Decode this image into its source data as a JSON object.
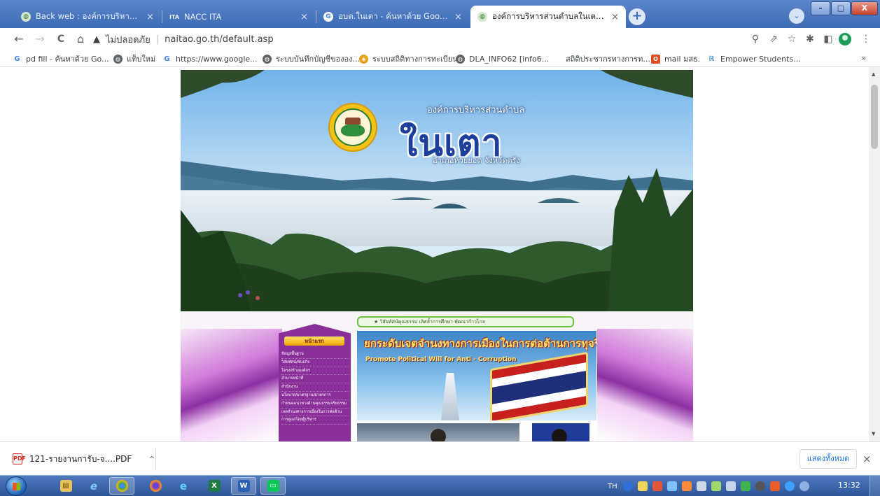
{
  "browser": {
    "tabs": [
      {
        "title": "Back web : องค์การบริหารส่วนตำบลใ",
        "close": "×",
        "favicon": "globe-icon",
        "active": false
      },
      {
        "title": "NACC ITA",
        "close": "×",
        "favicon": "ita-icon",
        "active": false
      },
      {
        "title": "อบต.ในเตา - ค้นหาด้วย Google",
        "close": "×",
        "favicon": "google-icon",
        "active": false
      },
      {
        "title": "องค์การบริหารส่วนตำบลในเตา เลขที่ 1",
        "close": "×",
        "favicon": "globe-icon",
        "active": true
      }
    ],
    "new_tab": "+",
    "tab_search": "⌄",
    "window_controls": {
      "minimize": "–",
      "maximize": "□",
      "close": "X"
    },
    "toolbar": {
      "back": "←",
      "forward": "→",
      "reload": "C",
      "home": "⌂",
      "security_warning": "▲",
      "security_text": "ไม่ปลอดภัย",
      "separator": "|",
      "url": "naitao.go.th/default.asp",
      "zoom": "⚲",
      "share": "⇗",
      "star": "☆",
      "extensions": "✱",
      "sidepanel": "◧",
      "menu": "⋮"
    },
    "bookmarks": [
      {
        "label": "pd fill - ค้นหาด้วย Go...",
        "icon": "google-icon"
      },
      {
        "label": "แท็บใหม่",
        "icon": "globe-icon"
      },
      {
        "label": "https://www.google...",
        "icon": "google-icon"
      },
      {
        "label": "ระบบบันทึกบัญชีขององ...",
        "icon": "globe-icon"
      },
      {
        "label": "ระบบสถิติทางการทะเบียน",
        "icon": "registry-icon"
      },
      {
        "label": "DLA_INFO62 [info6...",
        "icon": "globe-icon"
      },
      {
        "label": "สถิติประชากรทางการท...",
        "icon": "none"
      },
      {
        "label": "mail มสธ.",
        "icon": "office-icon"
      },
      {
        "label": "Empower Students...",
        "icon": "empower-icon"
      }
    ],
    "bookmarks_more": "»"
  },
  "website": {
    "banner": {
      "org_line": "องค์การบริหารส่วนตำบล",
      "org_name": "ในเตา",
      "district": "อำเภอห้วยยอด จังหวัดตรัง"
    },
    "marquee": "★ วิสัยทัศน์คุณธรรม เลิศล้ำการศึกษา พัฒนาก้าวไกล",
    "menu": {
      "header": "หน้าแรก",
      "items": [
        "ข้อมูลพื้นฐาน",
        "วิสัยทัศน์/พันธกิจ",
        "โครงสร้างองค์กร",
        "อำนาจหน้าที่",
        "สำนักงาน",
        "นโยบาย/มาตรฐาน/มาตรการ",
        "กำหนดแนวทางด้านคุณธรรมจริยธรรม",
        "เจตจำนงทางการเมืองในการต่อต้าน",
        "การดูแลโดยผู้บริหาร"
      ]
    },
    "news_banner": {
      "title": "ยกระดับเจตจำนงทางการเมืองในการต่อต้านการทุจริต",
      "subtitle": "Promote Political Will for Anti - Corruption"
    }
  },
  "download_bar": {
    "filename": "121-รายงานการับ-จ....PDF",
    "file_icon": "pdf-icon",
    "file_icon_text": "PDF",
    "caret": "^",
    "show_all": "แสดงทั้งหมด",
    "close": "×"
  },
  "taskbar": {
    "apps": [
      {
        "name": "explorer",
        "glyph": "▤"
      },
      {
        "name": "internet-explorer",
        "glyph": "e"
      },
      {
        "name": "chrome",
        "glyph": "●"
      },
      {
        "name": "firefox",
        "glyph": "◉"
      },
      {
        "name": "edge",
        "glyph": "e"
      },
      {
        "name": "excel",
        "glyph": "X"
      },
      {
        "name": "word",
        "glyph": "W"
      },
      {
        "name": "line",
        "glyph": "▭"
      }
    ],
    "language": "TH",
    "clock": "13:32"
  },
  "colors": {
    "tabstrip": "#3d6bb6",
    "taskbar": "#2d5699",
    "accent_link": "#1a73e8",
    "menu_purple": "#8a2e9a"
  }
}
